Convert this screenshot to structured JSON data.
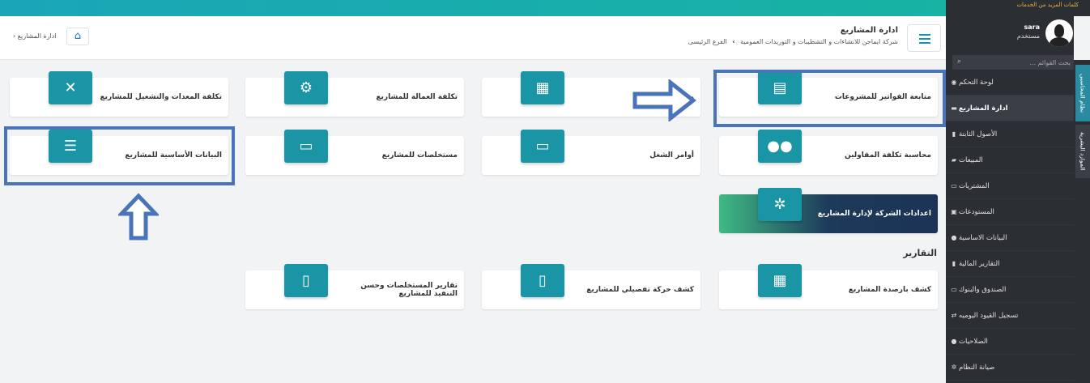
{
  "header": {
    "page_title": "ادارة المشاريع",
    "company": "شركة ايماجن للانشاءات و التشطيبات و التوريدات العمومية",
    "branch": "الفرع الرئيسى",
    "separator": "›",
    "home_crumb": "ادارة المشاريع"
  },
  "top_promo": "كلمات المزيد من الخدمات",
  "cards": {
    "invoices": "متابعة الفواتير للمشروعات",
    "projects_partial": "ريع",
    "labor_cost": "تكلفة العمالة للمشاريع",
    "equipment_cost": "تكلفة المعدات والتشغيل للمشاريع",
    "contractors": "محاسبة تكلفة المقاولين",
    "work_orders": "أوامر الشغل",
    "extracts": "مستخلصات للمشاريع",
    "basic_data": "البيانات الأساسية للمشاريع",
    "settings": "اعدادات الشركة لإدارة المشاريع",
    "balances": "كشف بارصدة المشاريع",
    "detailed_movement": "كشف حركة تفصيلي للمشاريع",
    "extract_reports": "تقارير المستخلصات وحسن التنفيذ للمشاريع"
  },
  "sections": {
    "reports": "التقارير"
  },
  "sidebar": {
    "user_name": "sara",
    "user_role": "مستخدم",
    "search_placeholder": "بحث القوائم ...",
    "items": [
      {
        "label": "لوحة التحكم",
        "icon": "dashboard-icon"
      },
      {
        "label": "ادارة المشاريع",
        "icon": "projects-icon"
      },
      {
        "label": "الأصول الثابتة",
        "icon": "file-icon"
      },
      {
        "label": "المبيعات",
        "icon": "truck-icon"
      },
      {
        "label": "المشتريات",
        "icon": "money-icon"
      },
      {
        "label": "المستودعات",
        "icon": "box-icon"
      },
      {
        "label": "البيانات الاساسية",
        "icon": "info-icon"
      },
      {
        "label": "التقارير المالية",
        "icon": "file-icon"
      },
      {
        "label": "الصندوق والبنوك",
        "icon": "money-icon"
      },
      {
        "label": "تسجيل القيود اليوميه",
        "icon": "exchange-icon"
      },
      {
        "label": "الصلاحيات",
        "icon": "users-icon"
      },
      {
        "label": "صيانة النظام",
        "icon": "gear-icon"
      }
    ],
    "vtabs": [
      "نظام المحاسبى",
      "الموارد البشرية"
    ]
  },
  "colors": {
    "teal": "#1995a6",
    "highlight": "#4a74ba",
    "sidebar": "#2b2e33"
  }
}
